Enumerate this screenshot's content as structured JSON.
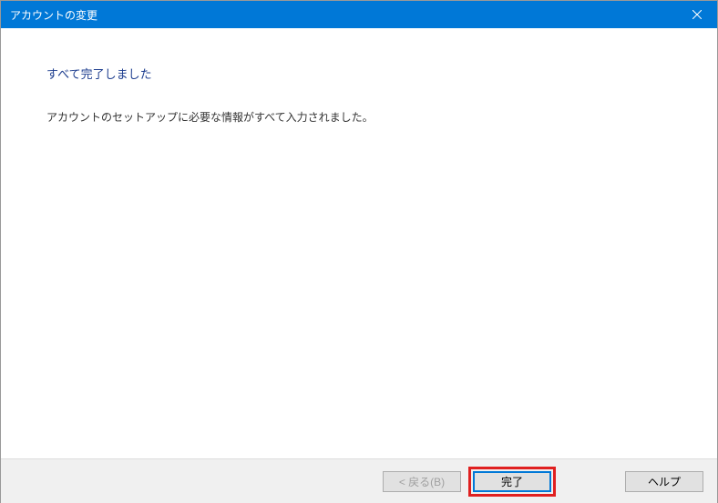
{
  "titlebar": {
    "title": "アカウントの変更"
  },
  "content": {
    "heading": "すべて完了しました",
    "description": "アカウントのセットアップに必要な情報がすべて入力されました。"
  },
  "footer": {
    "back_label": "< 戻る(B)",
    "finish_label": "完了",
    "help_label": "ヘルプ"
  }
}
